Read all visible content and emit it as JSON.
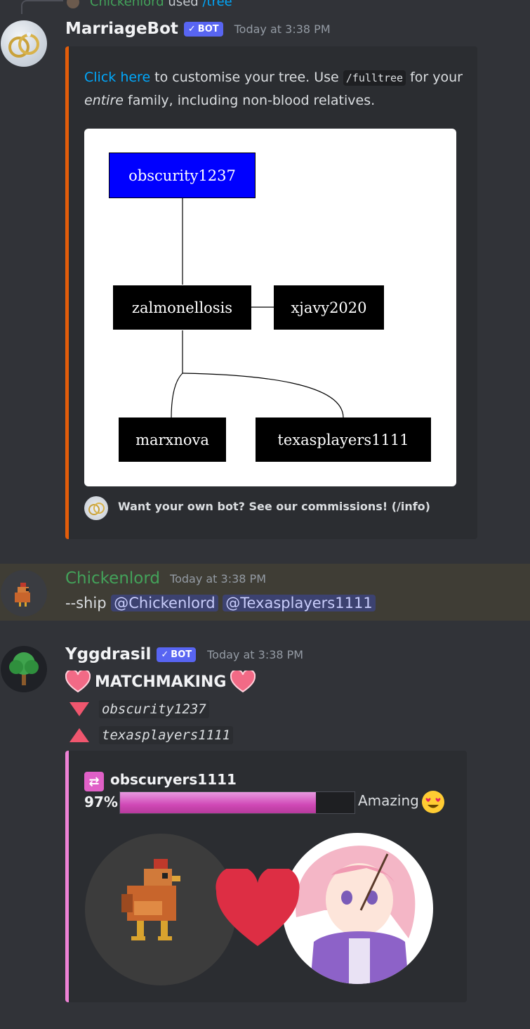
{
  "reply": {
    "author": "Chickenlord",
    "used": "used",
    "command": "/tree"
  },
  "marriagebot": {
    "username": "MarriageBot",
    "bot_tag": "BOT",
    "timestamp": "Today at 3:38 PM",
    "embed": {
      "accent_color": "#e35d0a",
      "link_text": "Click here",
      "text_1": " to customise your tree. Use ",
      "code": "/fulltree",
      "text_2": " for your ",
      "emphasis": "entire",
      "text_3": " family, including non-blood relatives.",
      "tree_nodes": [
        "obscurity1237",
        "zalmonellosis",
        "xjavy2020",
        "marxnova",
        "texasplayers1111"
      ],
      "footer": "Want your own bot? See our commissions! (/info)"
    }
  },
  "chickenlord_msg": {
    "username": "Chickenlord",
    "timestamp": "Today at 3:38 PM",
    "command": "--ship",
    "mention_1": "@Chickenlord",
    "mention_2": "@Texasplayers1111"
  },
  "yggdrasil": {
    "username": "Yggdrasil",
    "bot_tag": "BOT",
    "timestamp": "Today at 3:38 PM",
    "title": "MATCHMAKING",
    "user_1": "obscurity1237",
    "user_2": "texasplayers1111",
    "embed": {
      "accent_color": "#ee82d6",
      "author": "obscuryers1111",
      "percent_label": "97%",
      "percent_value": 0.97,
      "verdict": "Amazing"
    }
  }
}
